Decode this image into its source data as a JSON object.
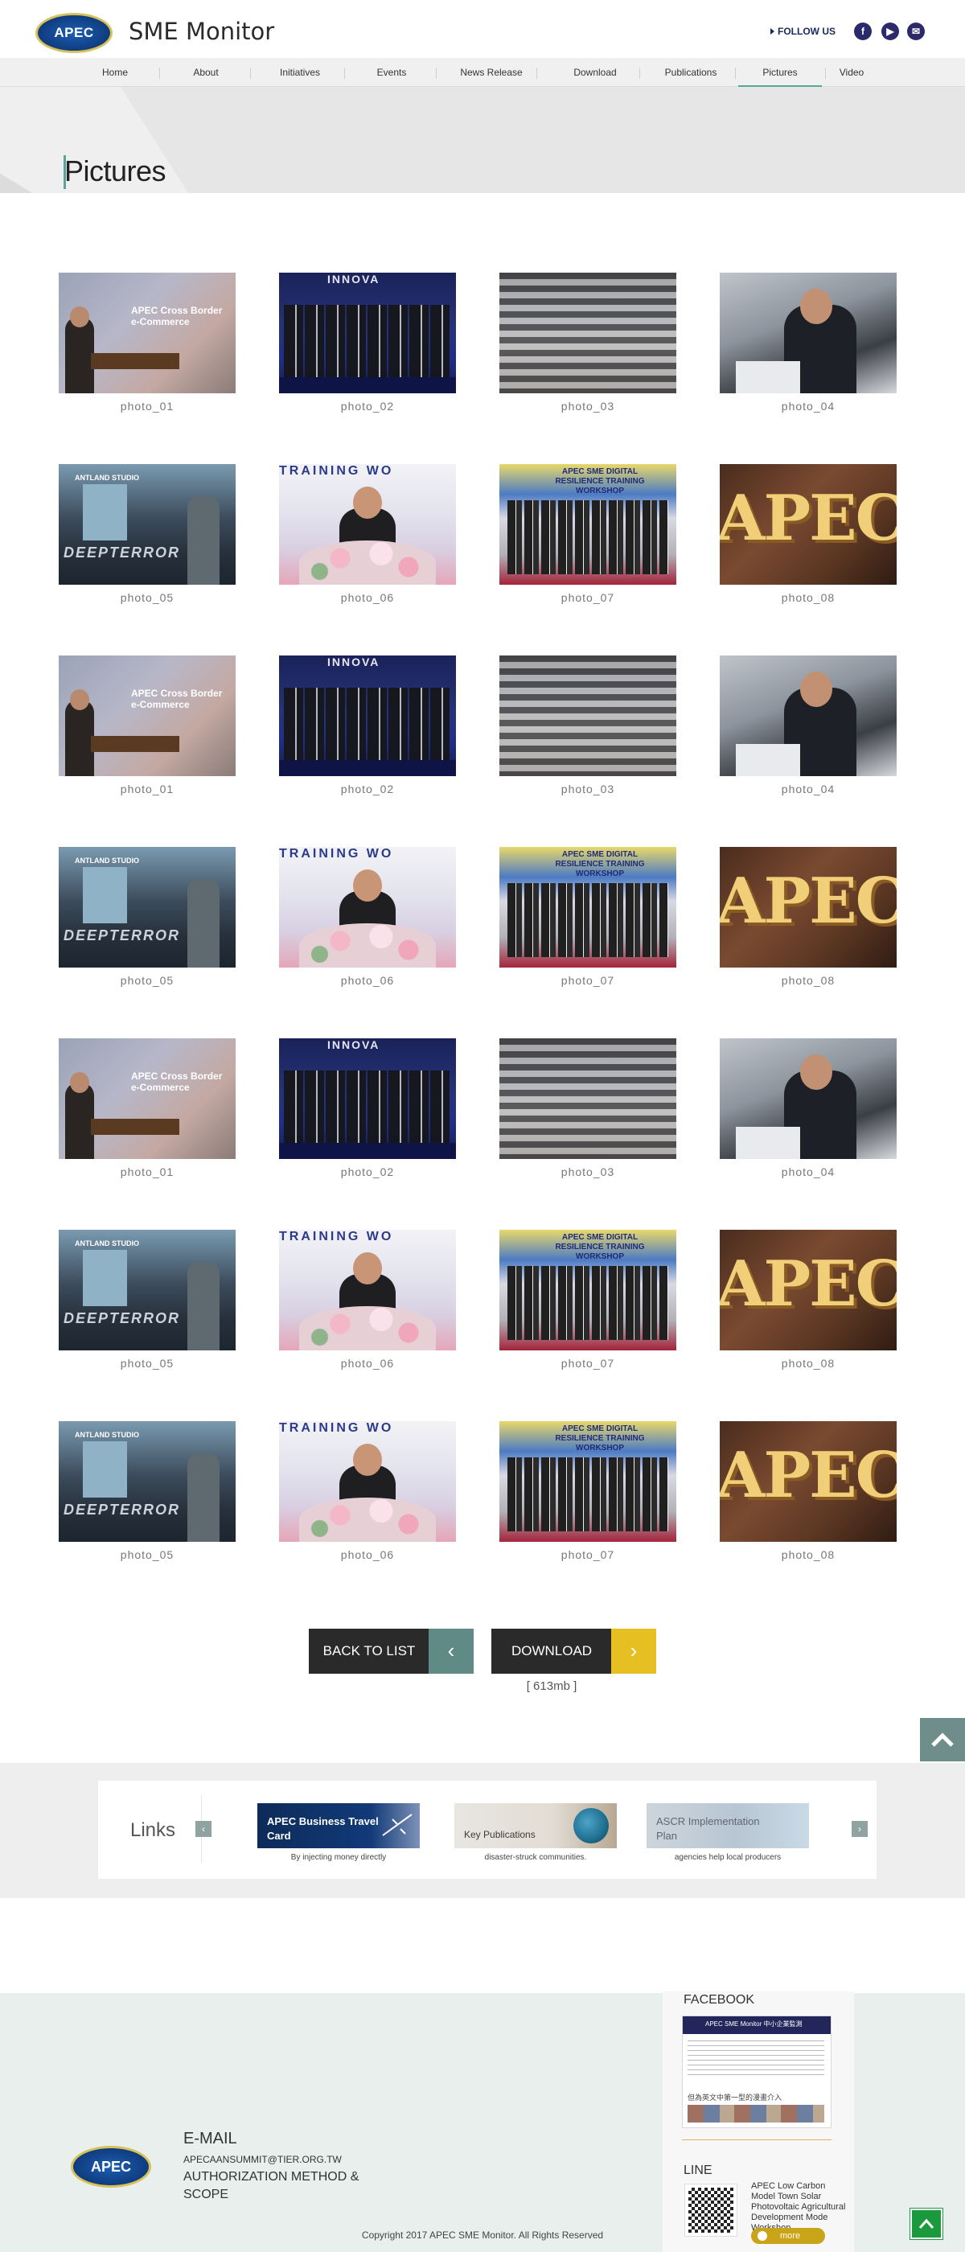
{
  "header": {
    "logo_text": "APEC",
    "site_title": "SME Monitor",
    "follow_label": "FOLLOW US",
    "social": [
      "facebook-icon",
      "youtube-icon",
      "mail-icon"
    ]
  },
  "nav": {
    "items": [
      "Home",
      "About",
      "Initiatives",
      "Events",
      "News Release",
      "Download",
      "Publications",
      "Pictures",
      "Video"
    ],
    "active": "Pictures"
  },
  "page": {
    "title": "Pictures"
  },
  "gallery": {
    "rows": [
      [
        "photo_01",
        "photo_02",
        "photo_03",
        "photo_04"
      ],
      [
        "photo_05",
        "photo_06",
        "photo_07",
        "photo_08"
      ],
      [
        "photo_01",
        "photo_02",
        "photo_03",
        "photo_04"
      ],
      [
        "photo_05",
        "photo_06",
        "photo_07",
        "photo_08"
      ],
      [
        "photo_01",
        "photo_02",
        "photo_03",
        "photo_04"
      ],
      [
        "photo_05",
        "photo_06",
        "photo_07",
        "photo_08"
      ],
      [
        "photo_05",
        "photo_06",
        "photo_07",
        "photo_08"
      ]
    ],
    "photo_text": {
      "p1": "APEC Cross Border e-Commerce",
      "p2": "INNOVA",
      "p5_label": "ANTLAND STUDIO",
      "p5_logo": "DEEPTERROR",
      "p6_banner": "TRAINING WO",
      "p7_title": "APEC SME DIGITAL RESILIENCE TRAINING WORKSHOP",
      "p8_text": "APEC"
    }
  },
  "actions": {
    "back_label": "BACK TO LIST",
    "download_label": "DOWNLOAD",
    "download_size": "[ 613mb ]"
  },
  "links": {
    "title": "Links",
    "cards": [
      {
        "text": "APEC Business Travel Card",
        "sub": "By injecting money directly"
      },
      {
        "text": "Key Publications",
        "sub": "disaster-struck communities."
      },
      {
        "text": "ASCR Implementation Plan",
        "sub": "agencies help local producers"
      }
    ]
  },
  "footer": {
    "logo_text": "APEC",
    "email_heading": "E-MAIL",
    "email": "APECAANSUMMIT@TIER.ORG.TW",
    "authorization": "AUTHORIZATION METHOD & SCOPE",
    "copyright": "Copyright 2017 APEC SME Monitor. All Rights Reserved",
    "facebook_heading": "FACEBOOK",
    "facebook_page": "APEC SME Monitor 中小企業監測",
    "facebook_caption": "但為英文中第一型的漫畫介入",
    "line_heading": "LINE",
    "line_text": "APEC Low Carbon Model Town Solar Photovoltaic Agricultural Development Mode Workshop",
    "more_label": "more"
  }
}
